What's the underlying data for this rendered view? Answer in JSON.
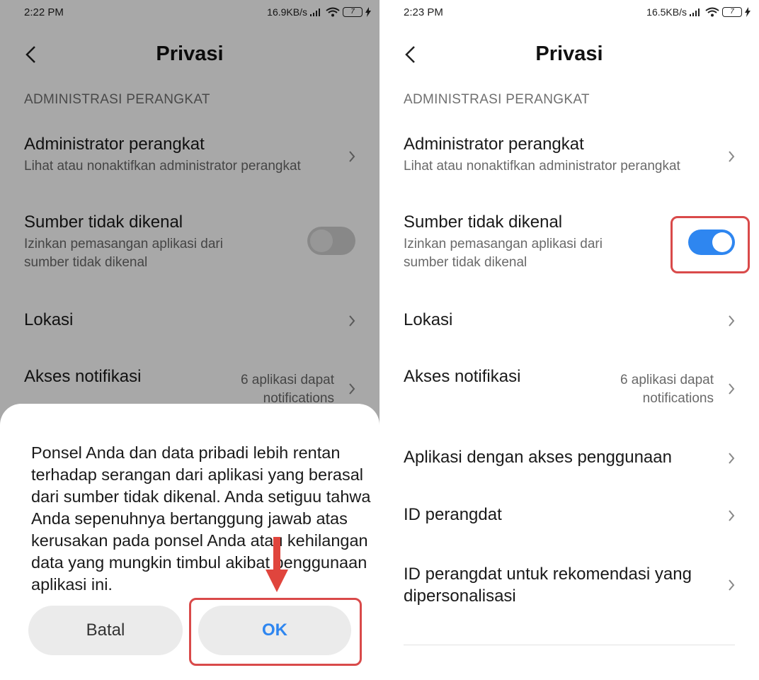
{
  "left": {
    "status": {
      "time": "2:22 PM",
      "speed": "16.9KB/s",
      "battery": "7"
    },
    "title": "Privasi",
    "section_header": "ADMINISTRASI PERANGKAT",
    "items": [
      {
        "label": "Administrator perangkat",
        "sub": "Lihat atau nonaktifkan administrator perangkat"
      },
      {
        "label": "Sumber tidak dikenal",
        "sub": "Izinkan pemasangan aplikasi dari sumber tidak dikenal",
        "toggle": "off"
      },
      {
        "label": "Lokasi"
      },
      {
        "label": "Akses notifikasi",
        "value": "6 aplikasi dapat notifications"
      }
    ],
    "dialog": {
      "message": "Ponsel Anda dan data pribadi lebih rentan terhadap serangan dari aplikasi yang berasal dari sumber tidak dikenal. Anda setiguu tahwa Anda sepenuhnya bertanggung jawab atas kerusakan pada ponsel Anda atau kehilangan data yang mungkin timbul akibat penggunaan aplikasi ini.",
      "cancel_label": "Batal",
      "ok_label": "OK"
    }
  },
  "right": {
    "status": {
      "time": "2:23 PM",
      "speed": "16.5KB/s",
      "battery": "7"
    },
    "title": "Privasi",
    "section_header": "ADMINISTRASI PERANGKAT",
    "items": [
      {
        "label": "Administrator perangkat",
        "sub": "Lihat atau nonaktifkan administrator perangkat"
      },
      {
        "label": "Sumber tidak dikenal",
        "sub": "Izinkan pemasangan aplikasi dari sumber tidak dikenal",
        "toggle": "on"
      },
      {
        "label": "Lokasi"
      },
      {
        "label": "Akses notifikasi",
        "value": "6 aplikasi dapat notifications"
      },
      {
        "label": "Aplikasi dengan akses penggunaan"
      },
      {
        "label": "ID perangdat"
      },
      {
        "label": "ID perangdat untuk rekomendasi yang dipersonalisasi"
      }
    ]
  },
  "colors": {
    "accent": "#2e86f0",
    "highlight": "#d94a4a",
    "overlay": "rgba(0,0,0,0.34)"
  },
  "icons": [
    "back-arrow-icon",
    "chevron-right-icon",
    "signal-icon",
    "wifi-icon",
    "battery-icon",
    "charging-icon",
    "down-arrow-icon"
  ]
}
